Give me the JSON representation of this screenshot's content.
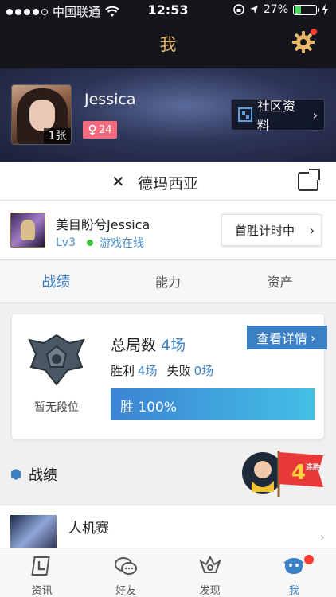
{
  "status_bar": {
    "carrier": "中国联通",
    "time": "12:53",
    "battery": "27%"
  },
  "nav": {
    "title": "我"
  },
  "profile": {
    "name": "Jessica",
    "photo_count": "1张",
    "gender_badge": "24",
    "community_label": "社区资料"
  },
  "game": {
    "title": "德玛西亚"
  },
  "character": {
    "name": "美目盼兮Jessica",
    "level": "Lv3",
    "status": "游戏在线",
    "first_win_label": "首胜计时中"
  },
  "tabs": [
    {
      "label": "战绩"
    },
    {
      "label": "能力"
    },
    {
      "label": "资产"
    }
  ],
  "stats": {
    "rank_label": "暂无段位",
    "total_label": "总局数",
    "total_value": "4场",
    "win_label": "胜利",
    "win_value": "4场",
    "loss_label": "失败",
    "loss_value": "0场",
    "detail_label": "查看详情",
    "win_rate_text": "胜 100%",
    "win_rate": 1.0
  },
  "section": {
    "title": "战绩"
  },
  "streak_badge": {
    "number": "4",
    "text": "连胜"
  },
  "match": {
    "mode": "人机赛"
  },
  "bottom_tabs": [
    {
      "label": "资讯"
    },
    {
      "label": "好友"
    },
    {
      "label": "发现"
    },
    {
      "label": "我"
    }
  ],
  "colors": {
    "accent": "#3b7fc4",
    "nav_title": "#e8b868",
    "badge_red": "#ff3b30"
  }
}
